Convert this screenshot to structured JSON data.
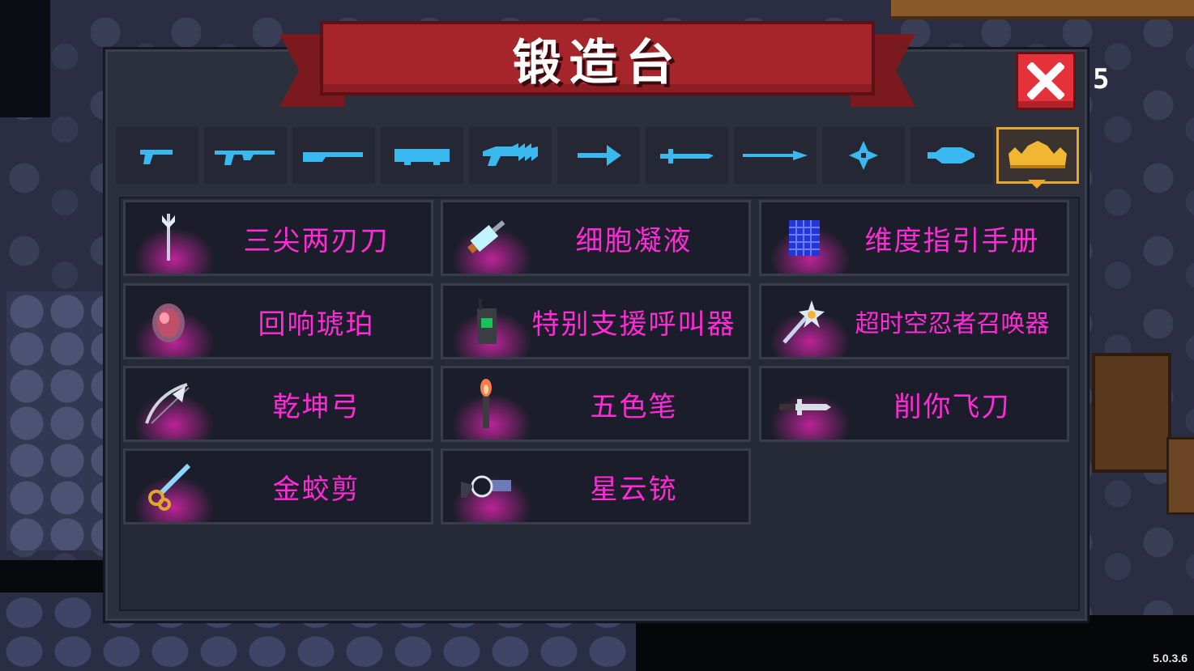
{
  "title": "锻造台",
  "version": "5.0.3.6",
  "background_number": "5",
  "colors": {
    "accent_pink": "#ff2bd6",
    "tab_icon_blue": "#3ab8f0",
    "active_tab_gold": "#e6a732",
    "ribbon_red": "#a5252b",
    "close_red": "#e5323a"
  },
  "tabs": [
    {
      "icon": "pistol-icon",
      "active": false
    },
    {
      "icon": "assault-rifle-icon",
      "active": false
    },
    {
      "icon": "shotgun-icon",
      "active": false
    },
    {
      "icon": "rocket-launcher-icon",
      "active": false
    },
    {
      "icon": "laser-gun-icon",
      "active": false
    },
    {
      "icon": "bow-arrow-icon",
      "active": false
    },
    {
      "icon": "sword-icon",
      "active": false
    },
    {
      "icon": "spear-icon",
      "active": false
    },
    {
      "icon": "shuriken-icon",
      "active": false
    },
    {
      "icon": "fish-staff-icon",
      "active": false
    },
    {
      "icon": "crown-icon",
      "active": true
    }
  ],
  "items": [
    {
      "label": "三尖两刃刀",
      "icon": "trident-icon"
    },
    {
      "label": "细胞凝液",
      "icon": "syringe-icon"
    },
    {
      "label": "维度指引手册",
      "icon": "grid-book-icon"
    },
    {
      "label": "回响琥珀",
      "icon": "amber-gem-icon"
    },
    {
      "label": "特别支援呼叫器",
      "icon": "radio-icon"
    },
    {
      "label": "超时空忍者召唤器",
      "icon": "star-staff-icon"
    },
    {
      "label": "乾坤弓",
      "icon": "feather-bow-icon"
    },
    {
      "label": "五色笔",
      "icon": "torch-brush-icon"
    },
    {
      "label": "削你飞刀",
      "icon": "throwing-knife-icon"
    },
    {
      "label": "金蛟剪",
      "icon": "golden-scissors-icon"
    },
    {
      "label": "星云铳",
      "icon": "nebula-gun-icon"
    }
  ]
}
